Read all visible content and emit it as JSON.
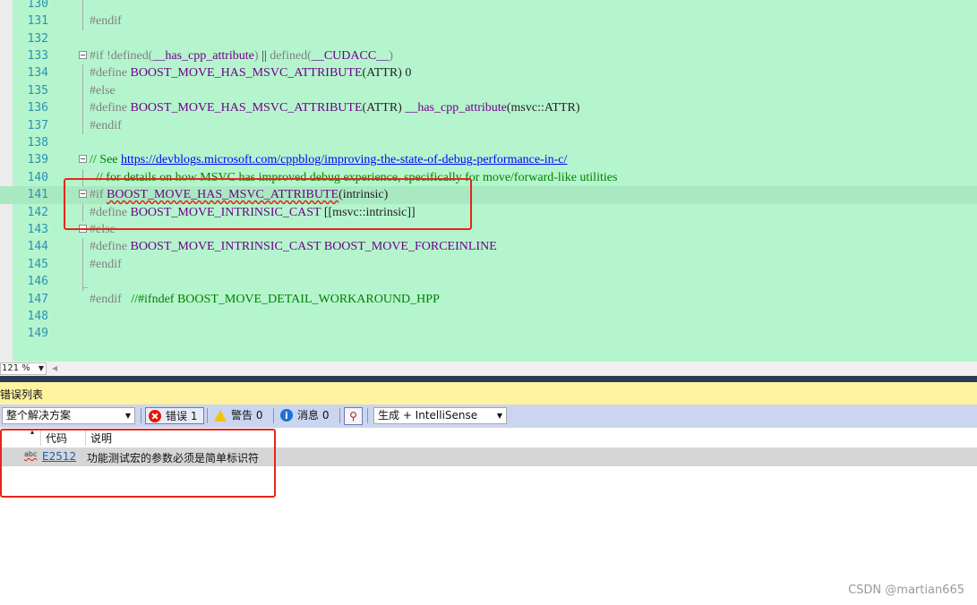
{
  "editor": {
    "lines": [
      {
        "num": "130",
        "code_html": ""
      },
      {
        "num": "131",
        "code_html": "<span class=\"pp\">#endif</span>"
      },
      {
        "num": "132",
        "code_html": ""
      },
      {
        "num": "133",
        "code_html": "<span class=\"pp\">#if</span> <span class=\"pp\">!defined(</span><span class=\"mac\">__has_cpp_attribute</span><span class=\"pp\">)</span> || <span class=\"pp\">defined(</span><span class=\"mac\">__CUDACC__</span><span class=\"pp\">)</span>"
      },
      {
        "num": "134",
        "code_html": "<span class=\"pp\">#define</span> <span class=\"mac\">BOOST_MOVE_HAS_MSVC_ATTRIBUTE</span>(ATTR) 0"
      },
      {
        "num": "135",
        "code_html": "<span class=\"pp\">#else</span>"
      },
      {
        "num": "136",
        "code_html": "<span class=\"pp\">#define</span> <span class=\"mac\">BOOST_MOVE_HAS_MSVC_ATTRIBUTE</span>(ATTR) <span class=\"mac\">__has_cpp_attribute</span>(msvc::ATTR)"
      },
      {
        "num": "137",
        "code_html": "<span class=\"pp\">#endif</span>"
      },
      {
        "num": "138",
        "code_html": ""
      },
      {
        "num": "139",
        "code_html": "<span class=\"cmt\">// See </span><span class=\"lnk\">https://devblogs.microsoft.com/cppblog/improving-the-state-of-debug-performance-in-c/</span>"
      },
      {
        "num": "140",
        "code_html": "<span class=\"cmt\">  // for details on how MSVC has improved debug experience, specifically for move/forward-like utilities</span>"
      },
      {
        "num": "141",
        "code_html": "<span class=\"pp\">#if</span> <span class=\"mac squig\">BOOST_MOVE_HAS_MSVC_ATTRIBUTE</span>(intrinsic)"
      },
      {
        "num": "142",
        "code_html": "<span class=\"pp\">#define</span> <span class=\"mac\">BOOST_MOVE_INTRINSIC_CAST</span> [[msvc::intrinsic]]"
      },
      {
        "num": "143",
        "code_html": "<span class=\"pp\">#else</span>"
      },
      {
        "num": "144",
        "code_html": "<span class=\"pp\">#define</span> <span class=\"mac\">BOOST_MOVE_INTRINSIC_CAST</span> <span class=\"mac\">BOOST_MOVE_FORCEINLINE</span>"
      },
      {
        "num": "145",
        "code_html": "<span class=\"pp\">#endif</span>"
      },
      {
        "num": "146",
        "code_html": ""
      },
      {
        "num": "147",
        "code_html": "<span class=\"pp\">#endif</span>   <span class=\"cmt\">//#ifndef BOOST_MOVE_DETAIL_WORKAROUND_HPP</span>"
      },
      {
        "num": "148",
        "code_html": ""
      },
      {
        "num": "149",
        "code_html": ""
      }
    ]
  },
  "zoom": {
    "value": "121 %"
  },
  "error_list": {
    "title": "错误列表",
    "scope": "整个解决方案",
    "errors_label": "错误 1",
    "warnings_label": "警告 0",
    "messages_label": "消息 0",
    "source": "生成 + IntelliSense",
    "columns": {
      "code": "代码",
      "description": "说明"
    },
    "rows": [
      {
        "icon": "abc",
        "code": "E2512",
        "description": "功能测试宏的参数必须是简单标识符"
      }
    ]
  },
  "watermark": "CSDN @martian665",
  "colors": {
    "editor_bg": "#b5f5cd",
    "annotation_red": "#e5261b",
    "title_bar_yellow": "#fff2a0"
  }
}
